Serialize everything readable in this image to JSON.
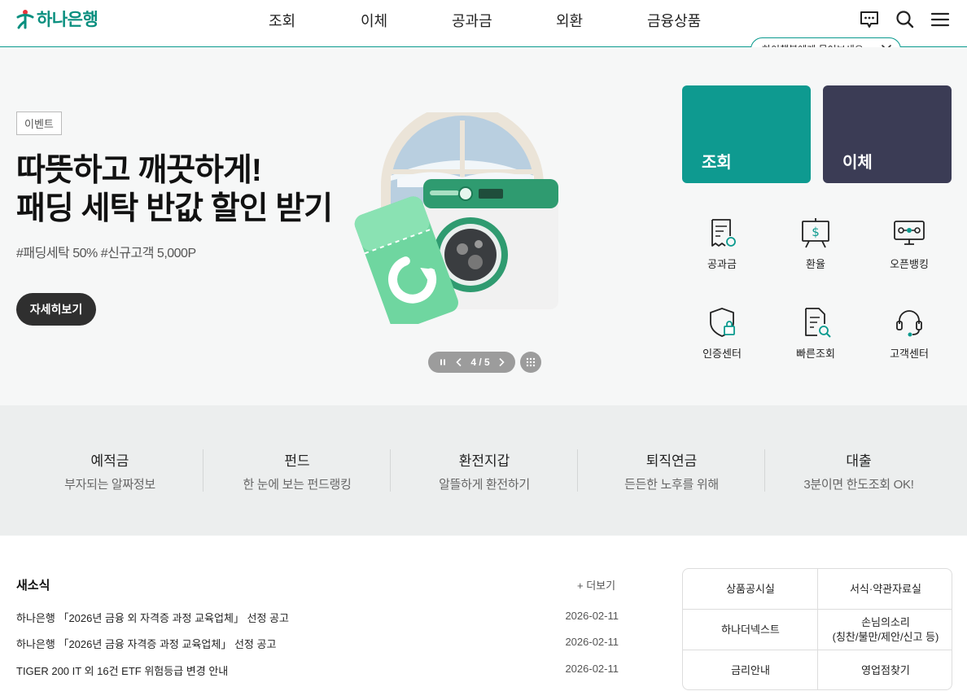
{
  "header": {
    "logo_text": "하나은행",
    "nav": [
      "조회",
      "이체",
      "공과금",
      "외환",
      "금융상품"
    ]
  },
  "chatbot_tip": {
    "text": "하이챗봇에게 물어보세요~"
  },
  "hero": {
    "tag": "이벤트",
    "title_line1": "따뜻하고 깨끗하게!",
    "title_line2": "패딩 세탁 반값 할인 받기",
    "hashtags": "#패딩세탁 50% #신규고객 5,000P",
    "button": "자세히보기",
    "pager": "4 / 5",
    "pager_current": 4,
    "pager_total": 5
  },
  "cards": {
    "inquiry": "조회",
    "transfer": "이체"
  },
  "quick_menu": [
    "공과금",
    "환율",
    "오픈뱅킹",
    "인증센터",
    "빠른조회",
    "고객센터"
  ],
  "categories": [
    {
      "title": "예적금",
      "sub": "부자되는 알짜정보"
    },
    {
      "title": "펀드",
      "sub": "한 눈에 보는 펀드랭킹"
    },
    {
      "title": "환전지갑",
      "sub": "알뜰하게 환전하기"
    },
    {
      "title": "퇴직연금",
      "sub": "든든한 노후를 위해"
    },
    {
      "title": "대출",
      "sub": "3분이면 한도조회 OK!"
    }
  ],
  "news": {
    "title": "새소식",
    "more": "+ 더보기",
    "items": [
      {
        "text": "하나은행 「2026년 금융 외 자격증 과정 교육업체」 선정 공고",
        "date": "2026-02-11"
      },
      {
        "text": "하나은행 「2026년 금융 자격증 과정 교육업체」 선정 공고",
        "date": "2026-02-11"
      },
      {
        "text": "TIGER 200 IT 외 16건 ETF 위험등급 변경 안내",
        "date": "2026-02-11"
      }
    ]
  },
  "links": {
    "r1c1": "상품공시실",
    "r1c2": "서식·약관자료실",
    "r2c1": "하나더넥스트",
    "r2c2_line1": "손님의소리",
    "r2c2_line2": "(칭찬/불만/제안/신고 등)",
    "r3c1": "금리안내",
    "r3c2": "영업점찾기"
  },
  "colors": {
    "brand": "#0a8f7f",
    "teal_card": "#0e9a90",
    "navy_card": "#3b3c55",
    "logo_red": "#e8343a"
  }
}
